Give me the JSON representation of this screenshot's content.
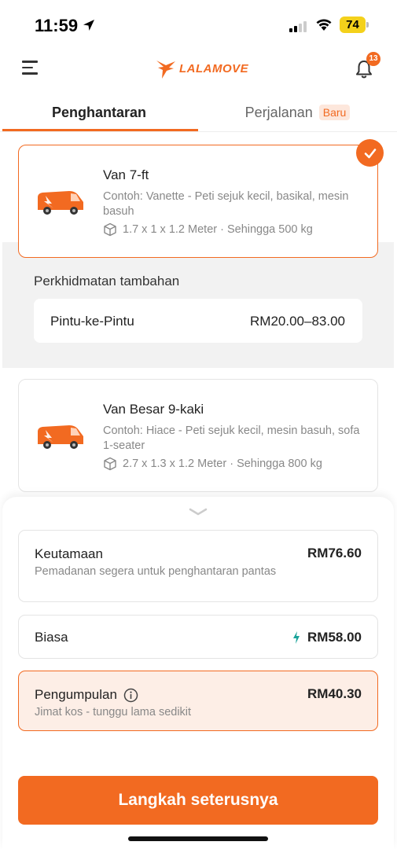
{
  "status_bar": {
    "time": "11:59",
    "battery": "74"
  },
  "header": {
    "logo_text": "LALAMOVE",
    "notification_count": "13"
  },
  "tabs": [
    {
      "label": "Penghantaran",
      "active": true
    },
    {
      "label": "Perjalanan",
      "badge": "Baru",
      "active": false
    }
  ],
  "vehicles": [
    {
      "title": "Van 7-ft",
      "example": "Contoh: Vanette - Peti sejuk kecil, basikal, mesin basuh",
      "spec": "1.7 x 1 x 1.2 Meter · Sehingga 500 kg",
      "selected": true
    },
    {
      "title": "Van Besar 9-kaki",
      "example": "Contoh: Hiace - Peti sejuk kecil, mesin basuh, sofa 1-seater",
      "spec": "2.7 x 1.3 x 1.2 Meter · Sehingga 800 kg",
      "selected": false
    }
  ],
  "additional_services": {
    "title": "Perkhidmatan tambahan",
    "items": [
      {
        "name": "Pintu-ke-Pintu",
        "price": "RM20.00–83.00"
      }
    ]
  },
  "delivery_options": [
    {
      "name": "Keutamaan",
      "price": "RM76.60",
      "description": "Pemadanan segera untuk penghantaran pantas",
      "selected": false
    },
    {
      "name": "Biasa",
      "price": "RM58.00",
      "description": "",
      "selected": false
    },
    {
      "name": "Pengumpulan",
      "price": "RM40.30",
      "description": "Jimat kos - tunggu lama sedikit",
      "selected": true
    }
  ],
  "cta_label": "Langkah seterusnya",
  "colors": {
    "accent": "#f26a21",
    "selected_bg": "#fdeee6",
    "lightning": "#1aa39a"
  }
}
